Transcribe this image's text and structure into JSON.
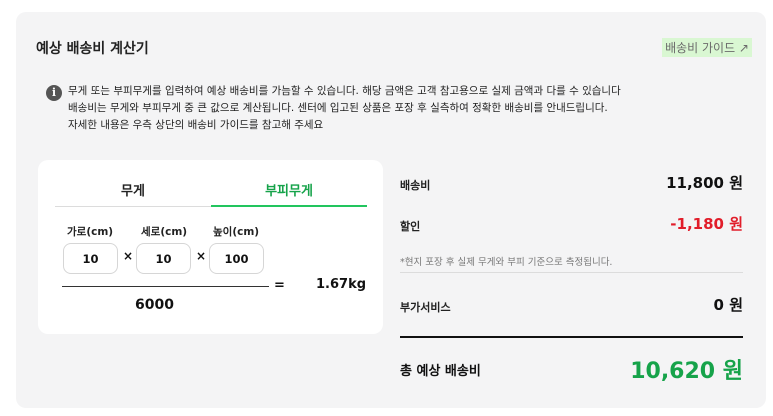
{
  "title": "예상 배송비 계산기",
  "guide_link": "배송비 가이드 ↗",
  "notice": {
    "icon": "info-icon",
    "lines": [
      "무게 또는 부피무게를 입력하여 예상 배송비를 가늠할 수 있습니다. 해당 금액은 고객 참고용으로 실제 금액과 다를 수 있습니다",
      "배송비는 무게와 부피무게 중 큰 값으로 계산됩니다. 센터에 입고된 상품은 포장 후 실측하여 정확한 배송비를 안내드립니다.",
      "자세한 내용은 우측 상단의 배송비 가이드를 참고해 주세요"
    ]
  },
  "tabs": {
    "weight": "무게",
    "volumetric": "부피무게",
    "active": "volumetric"
  },
  "dimensions": {
    "width_label": "가로(cm)",
    "length_label": "세로(cm)",
    "height_label": "높이(cm)",
    "width": "10",
    "length": "10",
    "height": "100",
    "times": "×",
    "equals": "=",
    "divisor": "6000",
    "result": "1.67kg"
  },
  "summary": {
    "shipping_label": "배송비",
    "shipping_value": "11,800 원",
    "discount_label": "할인",
    "discount_value": "-1,180 원",
    "note": "*현지 포장 후 실제 무게와 부피 기준으로 측정됩니다.",
    "addon_label": "부가서비스",
    "addon_value": "0 원",
    "total_label": "총 예상 배송비",
    "total_value": "10,620 원"
  },
  "colors": {
    "accent": "#16a34a",
    "discount": "#e11d2a",
    "card_bg": "#f4f4f5"
  }
}
